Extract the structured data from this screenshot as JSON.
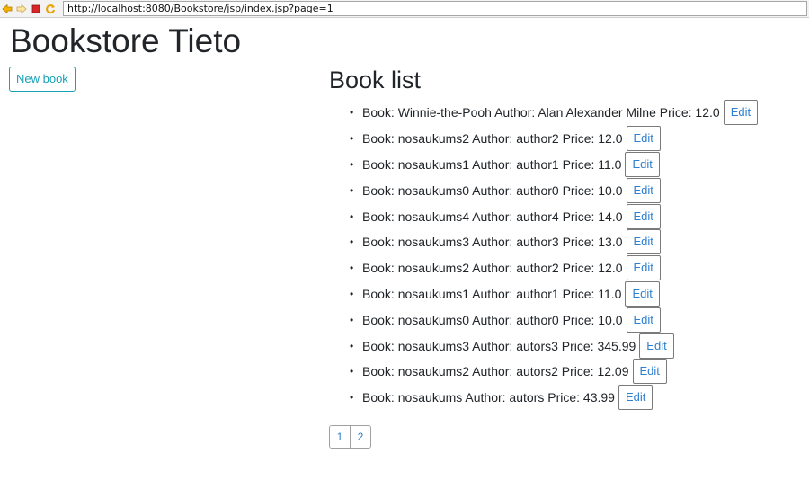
{
  "browser": {
    "url": "http://localhost:8080/Bookstore/jsp/index.jsp?page=1",
    "icons": [
      "back-arrow-icon",
      "forward-arrow-icon",
      "stop-icon",
      "refresh-icon"
    ]
  },
  "header": {
    "title": "Bookstore Tieto"
  },
  "toolbar": {
    "new_book_label": "New book"
  },
  "book_list": {
    "heading": "Book list",
    "edit_label": "Edit",
    "items": [
      "Book: Winnie-the-Pooh Author: Alan Alexander Milne Price: 12.0",
      "Book: nosaukums2 Author: author2 Price: 12.0",
      "Book: nosaukums1 Author: author1 Price: 11.0",
      "Book: nosaukums0 Author: author0 Price: 10.0",
      "Book: nosaukums4 Author: author4 Price: 14.0",
      "Book: nosaukums3 Author: author3 Price: 13.0",
      "Book: nosaukums2 Author: author2 Price: 12.0",
      "Book: nosaukums1 Author: author1 Price: 11.0",
      "Book: nosaukums0 Author: author0 Price: 10.0",
      "Book: nosaukums3 Author: autors3 Price: 345.99",
      "Book: nosaukums2 Author: autors2 Price: 12.09",
      "Book: nosaukums Author: autors Price: 43.99"
    ]
  },
  "pagination": {
    "pages": [
      "1",
      "2"
    ]
  },
  "colors": {
    "accent": "#17a2b8",
    "link": "#2f80d0",
    "text": "#212529"
  }
}
